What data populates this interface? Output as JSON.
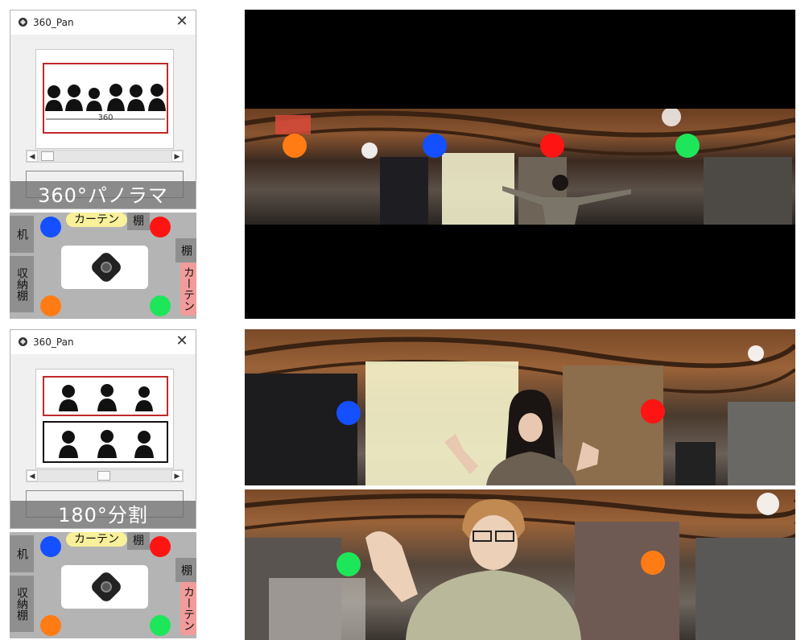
{
  "colors": {
    "orange": "#ff7c14",
    "blue": "#1450ff",
    "red": "#ff1414",
    "green": "#1ee65a",
    "map_bg": "#b4b4b4",
    "frame_red": "#c0282a"
  },
  "top_window": {
    "title": "360_Pan",
    "close_icon": "✕",
    "mode_label": "360°パノラマ",
    "scroll_left": "◀",
    "scroll_right": "▶",
    "preview_caption": "360"
  },
  "bottom_window": {
    "title": "360_Pan",
    "close_icon": "✕",
    "mode_label": "180°分割",
    "scroll_left": "◀",
    "scroll_right": "▶"
  },
  "room_map_top": {
    "label_curtain_top": "カーテン",
    "label_shelf_top": "棚",
    "label_desk": "机",
    "label_storage": "収納棚",
    "label_shelf_right": "棚",
    "label_curtain_right": "カーテン"
  },
  "room_map_bottom": {
    "label_curtain_top": "カーテン",
    "label_shelf_top": "棚",
    "label_desk": "机",
    "label_storage": "収納棚",
    "label_shelf_right": "棚",
    "label_curtain_right": "カーテン"
  }
}
